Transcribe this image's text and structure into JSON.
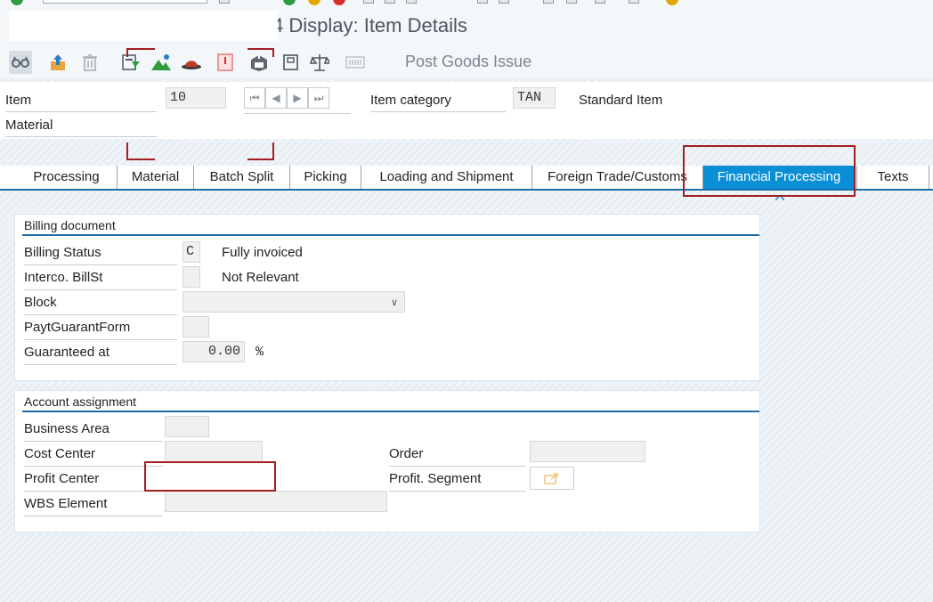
{
  "window": {
    "title": "4 Display: Item Details"
  },
  "toolbar": {
    "icons": [
      "glasses-icon",
      "upload-icon",
      "trash-icon",
      "filter-icon",
      "mountain-icon",
      "hat-icon",
      "note-icon",
      "box-icon",
      "copy-icon",
      "scale-icon",
      "barcode-icon"
    ],
    "post_goods_issue_label": "Post Goods Issue"
  },
  "header": {
    "item_label": "Item",
    "item_value": "10",
    "item_category_label": "Item category",
    "item_category_value": "TAN",
    "item_category_text": "Standard Item",
    "material_label": "Material",
    "material_value": ""
  },
  "tabs": [
    {
      "label": "Processing"
    },
    {
      "label": "Material"
    },
    {
      "label": "Batch Split"
    },
    {
      "label": "Picking"
    },
    {
      "label": "Loading and Shipment"
    },
    {
      "label": "Foreign Trade/Customs"
    },
    {
      "label": "Financial Processing",
      "active": true
    },
    {
      "label": "Texts"
    }
  ],
  "billing": {
    "title": "Billing document",
    "billing_status_label": "Billing Status",
    "billing_status_value": "C",
    "billing_status_text": "Fully invoiced",
    "interco_label": "Interco. BillSt",
    "interco_value": "",
    "interco_text": "Not Relevant",
    "block_label": "Block",
    "block_value": "",
    "payt_label": "PaytGuarantForm",
    "payt_value": "",
    "guaranteed_label": "Guaranteed at",
    "guaranteed_value": "0.00",
    "guaranteed_unit": "%"
  },
  "account": {
    "title": "Account assignment",
    "business_area_label": "Business Area",
    "business_area_value": "",
    "cost_center_label": "Cost Center",
    "cost_center_value": "",
    "order_label": "Order",
    "order_value": "",
    "profit_center_label": "Profit Center",
    "profit_center_value": "",
    "profit_segment_label": "Profit. Segment",
    "wbs_label": "WBS Element",
    "wbs_value": ""
  },
  "colors": {
    "active_tab": "#0a8fd6",
    "group_underline": "#1e6aa5",
    "annotation_red": "#a41d22"
  }
}
